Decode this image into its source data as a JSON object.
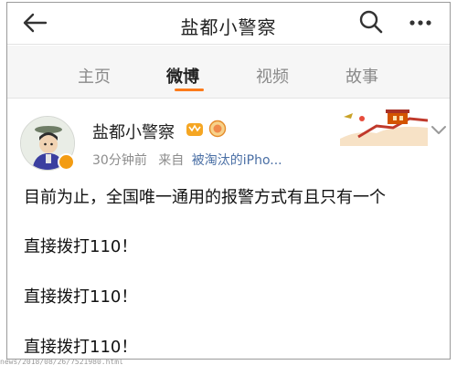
{
  "header": {
    "title": "盐都小警察",
    "back_icon": "back-arrow-icon",
    "search_icon": "search-icon",
    "more_icon": "more-dots-icon"
  },
  "tabs": [
    {
      "label": "主页",
      "active": false
    },
    {
      "label": "微博",
      "active": true
    },
    {
      "label": "视频",
      "active": false
    },
    {
      "label": "故事",
      "active": false
    }
  ],
  "accent_color": "#fc7a1a",
  "post": {
    "author": "盐都小警察",
    "time": "30分钟前",
    "source_prefix": "来自",
    "source": "被淘汰的iPho...",
    "lines": [
      "目前为止，全国唯一通用的报警方式有且只有一个",
      "直接拨打110！",
      "直接拨打110！",
      "直接拨打110！"
    ]
  },
  "footer": {
    "url": "news/2018/08/26/7521980.html"
  }
}
